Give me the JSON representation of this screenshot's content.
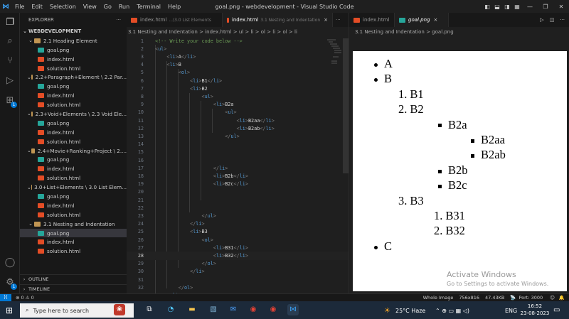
{
  "titlebar": {
    "menu": [
      "File",
      "Edit",
      "Selection",
      "View",
      "Go",
      "Run",
      "Terminal",
      "Help"
    ],
    "title": "goal.png - webdevelopment - Visual Studio Code"
  },
  "explorer": {
    "header": "EXPLORER",
    "more": "···",
    "root": "WEBDEVELOPMENT",
    "rows": [
      {
        "label": "2.1 Heading Element",
        "type": "folder"
      },
      {
        "label": "goal.png",
        "type": "img"
      },
      {
        "label": "index.html",
        "type": "html"
      },
      {
        "label": "solution.html",
        "type": "html"
      },
      {
        "label": "2.2+Paragraph+Element \\ 2.2 Par...",
        "type": "folder"
      },
      {
        "label": "goal.png",
        "type": "img"
      },
      {
        "label": "index.html",
        "type": "html"
      },
      {
        "label": "solution.html",
        "type": "html"
      },
      {
        "label": "2.3+Void+Elements \\ 2.3 Void Ele...",
        "type": "folder"
      },
      {
        "label": "goal.png",
        "type": "img"
      },
      {
        "label": "index.html",
        "type": "html"
      },
      {
        "label": "solution.html",
        "type": "html"
      },
      {
        "label": "2.4+Movie+Ranking+Project \\ 2....",
        "type": "folder"
      },
      {
        "label": "goal.png",
        "type": "img"
      },
      {
        "label": "index.html",
        "type": "html"
      },
      {
        "label": "solution.html",
        "type": "html"
      },
      {
        "label": "3.0+List+Elements \\ 3.0 List Elem...",
        "type": "folder"
      },
      {
        "label": "goal.png",
        "type": "img"
      },
      {
        "label": "index.html",
        "type": "html"
      },
      {
        "label": "solution.html",
        "type": "html"
      },
      {
        "label": "3.1 Nesting and Indentation",
        "type": "folder"
      },
      {
        "label": "goal.png",
        "type": "img",
        "selected": true
      },
      {
        "label": "index.html",
        "type": "html"
      },
      {
        "label": "solution.html",
        "type": "html"
      }
    ],
    "outline": "OUTLINE",
    "timeline": "TIMELINE"
  },
  "editor1": {
    "tabs": [
      {
        "label": "index.html",
        "sub": "...\\3.0 List Elements",
        "active": false
      },
      {
        "label": "index.html",
        "sub": "3.1 Nesting and Indentation",
        "active": true,
        "close": "×"
      }
    ],
    "tabs_more": "···",
    "breadcrumb": "3.1 Nesting and Indentation > index.html > ul > li > ol > li > ol > li",
    "lines": [
      {
        "n": "1",
        "seg": [
          [
            "cm",
            "<!-- Write your code below -->"
          ]
        ]
      },
      {
        "n": "2",
        "seg": [
          [
            "tg",
            "<"
          ],
          [
            "tn",
            "ul"
          ],
          [
            "tg",
            ">"
          ]
        ]
      },
      {
        "n": "3",
        "seg": [
          [
            "tx",
            "    "
          ],
          [
            "tg",
            "<"
          ],
          [
            "tn",
            "li"
          ],
          [
            "tg",
            ">"
          ],
          [
            "tx",
            "A"
          ],
          [
            "tg",
            "</"
          ],
          [
            "tn",
            "li"
          ],
          [
            "tg",
            ">"
          ]
        ]
      },
      {
        "n": "4",
        "seg": [
          [
            "tx",
            "    "
          ],
          [
            "tg",
            "<"
          ],
          [
            "tn",
            "li"
          ],
          [
            "tg",
            ">"
          ],
          [
            "tx",
            "B"
          ]
        ]
      },
      {
        "n": "5",
        "seg": [
          [
            "tx",
            "        "
          ],
          [
            "tg",
            "<"
          ],
          [
            "tn",
            "ol"
          ],
          [
            "tg",
            ">"
          ]
        ]
      },
      {
        "n": "6",
        "seg": [
          [
            "tx",
            "            "
          ],
          [
            "tg",
            "<"
          ],
          [
            "tn",
            "li"
          ],
          [
            "tg",
            ">"
          ],
          [
            "tx",
            "B1"
          ],
          [
            "tg",
            "</"
          ],
          [
            "tn",
            "li"
          ],
          [
            "tg",
            ">"
          ]
        ]
      },
      {
        "n": "7",
        "seg": [
          [
            "tx",
            "            "
          ],
          [
            "tg",
            "<"
          ],
          [
            "tn",
            "li"
          ],
          [
            "tg",
            ">"
          ],
          [
            "tx",
            "B2"
          ]
        ]
      },
      {
        "n": "8",
        "seg": [
          [
            "tx",
            "                "
          ],
          [
            "tg",
            "<"
          ],
          [
            "tn",
            "ul"
          ],
          [
            "tg",
            ">"
          ]
        ]
      },
      {
        "n": "9",
        "seg": [
          [
            "tx",
            "                    "
          ],
          [
            "tg",
            "<"
          ],
          [
            "tn",
            "li"
          ],
          [
            "tg",
            ">"
          ],
          [
            "tx",
            "B2a"
          ]
        ]
      },
      {
        "n": "10",
        "seg": [
          [
            "tx",
            "                        "
          ],
          [
            "tg",
            "<"
          ],
          [
            "tn",
            "ul"
          ],
          [
            "tg",
            ">"
          ]
        ]
      },
      {
        "n": "11",
        "seg": [
          [
            "tx",
            "                            "
          ],
          [
            "tg",
            "<"
          ],
          [
            "tn",
            "li"
          ],
          [
            "tg",
            ">"
          ],
          [
            "tx",
            "B2aa"
          ],
          [
            "tg",
            "</"
          ],
          [
            "tn",
            "li"
          ],
          [
            "tg",
            ">"
          ]
        ]
      },
      {
        "n": "12",
        "seg": [
          [
            "tx",
            "                            "
          ],
          [
            "tg",
            "<"
          ],
          [
            "tn",
            "li"
          ],
          [
            "tg",
            ">"
          ],
          [
            "tx",
            "B2ab"
          ],
          [
            "tg",
            "</"
          ],
          [
            "tn",
            "li"
          ],
          [
            "tg",
            ">"
          ]
        ]
      },
      {
        "n": "13",
        "seg": [
          [
            "tx",
            "                        "
          ],
          [
            "tg",
            "</"
          ],
          [
            "tn",
            "ul"
          ],
          [
            "tg",
            ">"
          ]
        ]
      },
      {
        "n": "14",
        "seg": []
      },
      {
        "n": "15",
        "seg": []
      },
      {
        "n": "16",
        "seg": []
      },
      {
        "n": "17",
        "seg": [
          [
            "tx",
            "                    "
          ],
          [
            "tg",
            "</"
          ],
          [
            "tn",
            "li"
          ],
          [
            "tg",
            ">"
          ]
        ]
      },
      {
        "n": "18",
        "seg": [
          [
            "tx",
            "                    "
          ],
          [
            "tg",
            "<"
          ],
          [
            "tn",
            "li"
          ],
          [
            "tg",
            ">"
          ],
          [
            "tx",
            "B2b"
          ],
          [
            "tg",
            "</"
          ],
          [
            "tn",
            "li"
          ],
          [
            "tg",
            ">"
          ]
        ]
      },
      {
        "n": "19",
        "seg": [
          [
            "tx",
            "                    "
          ],
          [
            "tg",
            "<"
          ],
          [
            "tn",
            "li"
          ],
          [
            "tg",
            ">"
          ],
          [
            "tx",
            "B2c"
          ],
          [
            "tg",
            "</"
          ],
          [
            "tn",
            "li"
          ],
          [
            "tg",
            ">"
          ]
        ]
      },
      {
        "n": "20",
        "seg": []
      },
      {
        "n": "21",
        "seg": []
      },
      {
        "n": "22",
        "seg": []
      },
      {
        "n": "23",
        "seg": [
          [
            "tx",
            "                "
          ],
          [
            "tg",
            "</"
          ],
          [
            "tn",
            "ul"
          ],
          [
            "tg",
            ">"
          ]
        ]
      },
      {
        "n": "24",
        "seg": [
          [
            "tx",
            "            "
          ],
          [
            "tg",
            "</"
          ],
          [
            "tn",
            "li"
          ],
          [
            "tg",
            ">"
          ]
        ]
      },
      {
        "n": "25",
        "seg": [
          [
            "tx",
            "            "
          ],
          [
            "tg",
            "<"
          ],
          [
            "tn",
            "li"
          ],
          [
            "tg",
            ">"
          ],
          [
            "tx",
            "B3"
          ]
        ]
      },
      {
        "n": "26",
        "seg": [
          [
            "tx",
            "                "
          ],
          [
            "tg",
            "<"
          ],
          [
            "tn",
            "ol"
          ],
          [
            "tg",
            ">"
          ]
        ]
      },
      {
        "n": "27",
        "seg": [
          [
            "tx",
            "                    "
          ],
          [
            "tg",
            "<"
          ],
          [
            "tn",
            "li"
          ],
          [
            "tg",
            ">"
          ],
          [
            "tx",
            "B31"
          ],
          [
            "tg",
            "</"
          ],
          [
            "tn",
            "li"
          ],
          [
            "tg",
            ">"
          ]
        ]
      },
      {
        "n": "28",
        "seg": [
          [
            "tx",
            "                    "
          ],
          [
            "tg",
            "<"
          ],
          [
            "tn",
            "li"
          ],
          [
            "tg",
            ">"
          ],
          [
            "tx",
            "B32"
          ],
          [
            "tg",
            "</"
          ],
          [
            "tn",
            "li"
          ],
          [
            "tg",
            ">"
          ]
        ],
        "cur": true
      },
      {
        "n": "29",
        "seg": [
          [
            "tx",
            "                "
          ],
          [
            "tg",
            "</"
          ],
          [
            "tn",
            "ol"
          ],
          [
            "tg",
            ">"
          ]
        ]
      },
      {
        "n": "30",
        "seg": [
          [
            "tx",
            "            "
          ],
          [
            "tg",
            "</"
          ],
          [
            "tn",
            "li"
          ],
          [
            "tg",
            ">"
          ]
        ]
      },
      {
        "n": "31",
        "seg": []
      },
      {
        "n": "32",
        "seg": [
          [
            "tx",
            "        "
          ],
          [
            "tg",
            "</"
          ],
          [
            "tn",
            "ol"
          ],
          [
            "tg",
            ">"
          ]
        ]
      },
      {
        "n": "33",
        "seg": [
          [
            "tx",
            "    "
          ],
          [
            "tg",
            "</"
          ],
          [
            "tn",
            "li"
          ],
          [
            "tg",
            ">"
          ]
        ]
      }
    ]
  },
  "editor2": {
    "tabs": [
      {
        "label": "index.html",
        "active": false
      },
      {
        "label": "goal.png",
        "active": true,
        "close": "×"
      }
    ],
    "breadcrumb": "3.1 Nesting and Indentation > goal.png",
    "preview": [
      {
        "text": "A",
        "marker": "disc",
        "level": 0
      },
      {
        "text": "B",
        "marker": "disc",
        "level": 0
      },
      {
        "text": "B1",
        "marker": "1.",
        "level": 1
      },
      {
        "text": "B2",
        "marker": "2.",
        "level": 1
      },
      {
        "text": "B2a",
        "marker": "square",
        "level": 2
      },
      {
        "text": "B2aa",
        "marker": "square",
        "level": 3
      },
      {
        "text": "B2ab",
        "marker": "square",
        "level": 3
      },
      {
        "text": "B2b",
        "marker": "square",
        "level": 2
      },
      {
        "text": "B2c",
        "marker": "square",
        "level": 2
      },
      {
        "text": "B3",
        "marker": "3.",
        "level": 1
      },
      {
        "text": "B31",
        "marker": "1.",
        "level": 2
      },
      {
        "text": "B32",
        "marker": "2.",
        "level": 2
      },
      {
        "text": "C",
        "marker": "disc",
        "level": 0
      }
    ]
  },
  "watermark": {
    "line1": "Activate Windows",
    "line2": "Go to Settings to activate Windows."
  },
  "statusbar": {
    "problems": "⊗ 0 ⚠ 0",
    "left_extra": "",
    "whole_image": "Whole Image",
    "dims": "756x816",
    "size": "47.43KB",
    "port": "Port: 3000"
  },
  "taskbar": {
    "search_placeholder": "Type here to search",
    "weather": "25°C  Haze",
    "lang": "ENG",
    "time": "16:52",
    "date": "23-08-2023"
  },
  "colors": {
    "accent": "#0078d4",
    "html_icon": "#e44d26",
    "img_icon": "#26a69a"
  }
}
